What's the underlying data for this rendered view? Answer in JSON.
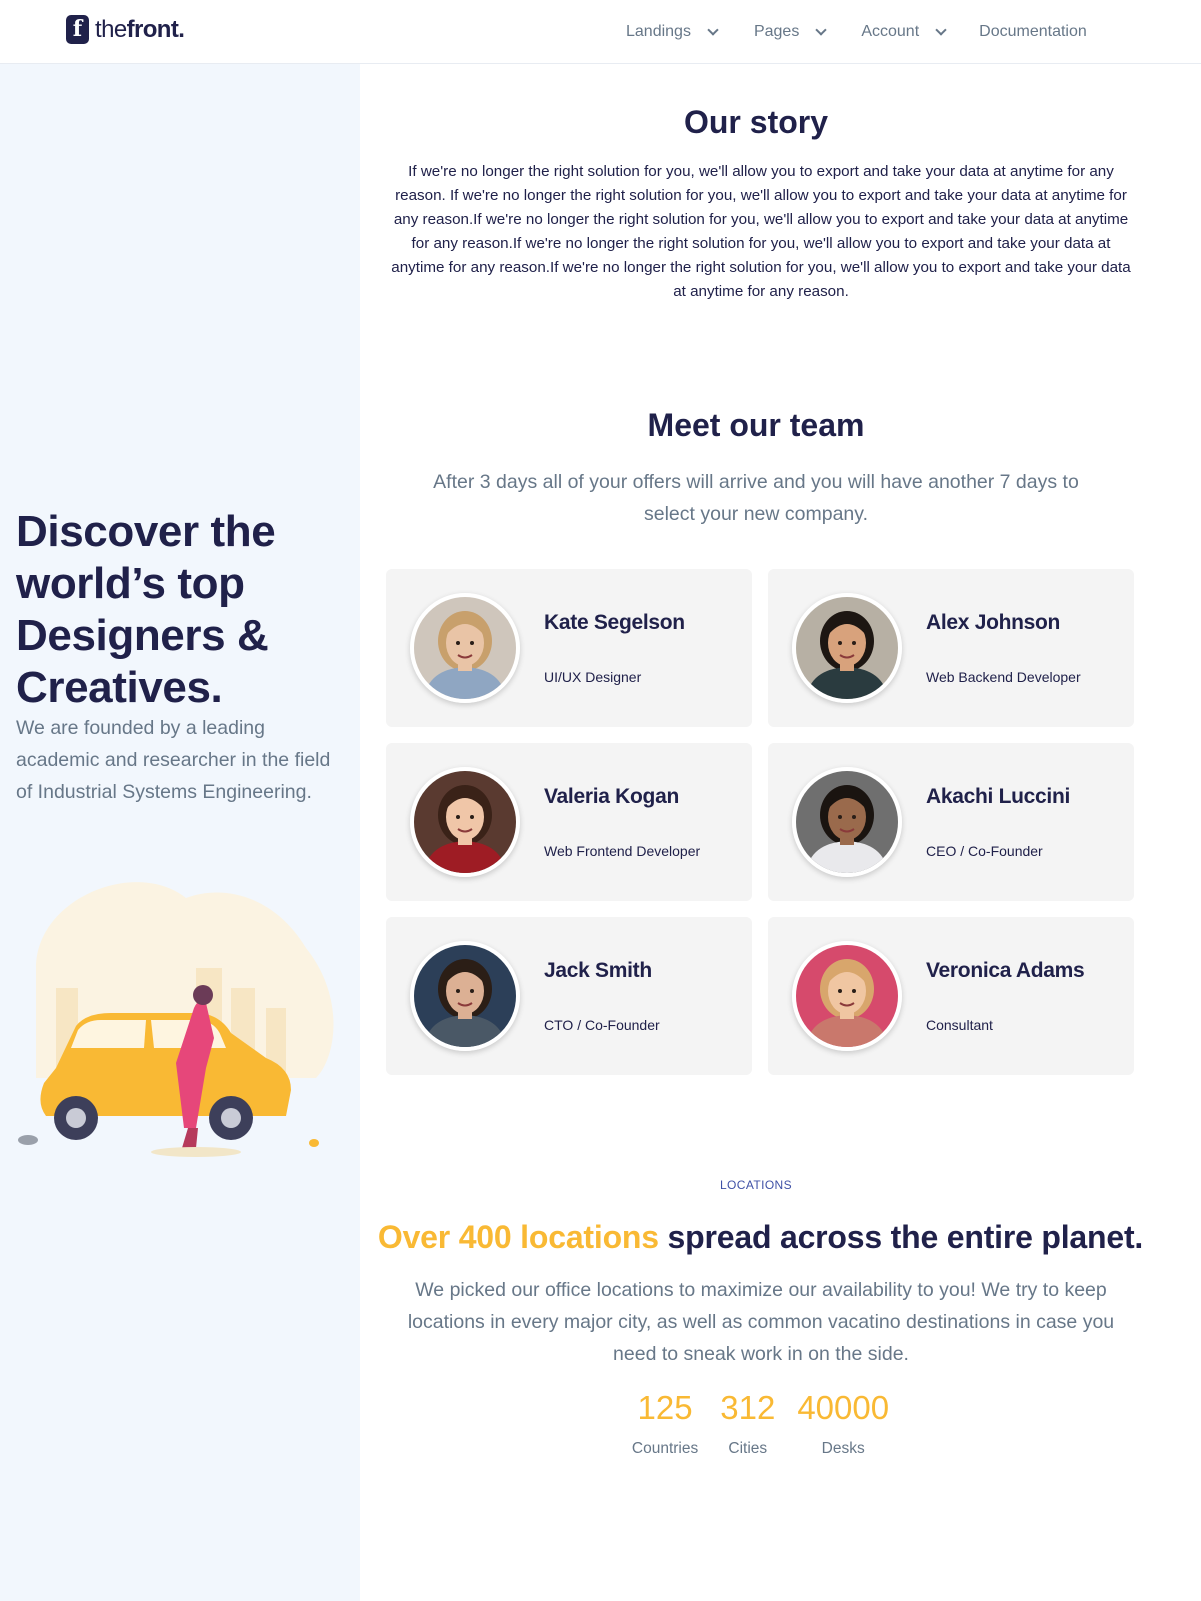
{
  "header": {
    "logo_letter": "f",
    "logo_text_a": "the",
    "logo_text_b": "front",
    "logo_text_c": ".",
    "nav": [
      {
        "label": "Landings",
        "dropdown": true
      },
      {
        "label": "Pages",
        "dropdown": true
      },
      {
        "label": "Account",
        "dropdown": true
      },
      {
        "label": "Documentation",
        "dropdown": false
      }
    ]
  },
  "hero": {
    "title": "Discover the world’s top Designers & Creatives.",
    "subtitle": "We are founded by a leading academic and researcher in the field of Industrial Systems Engineering.",
    "illustration_icon": "car-woman-illustration"
  },
  "story": {
    "title": "Our story",
    "body": "If we're no longer the right solution for you, we'll allow you to export and take your data at anytime for any reason. If we're no longer the right solution for you, we'll allow you to export and take your data at anytime for any reason.If we're no longer the right solution for you, we'll allow you to export and take your data at anytime for any reason.If we're no longer the right solution for you, we'll allow you to export and take your data at anytime for any reason.If we're no longer the right solution for you, we'll allow you to export and take your data at anytime for any reason."
  },
  "team": {
    "title": "Meet our team",
    "subtitle": "After 3 days all of your offers will arrive and you will have another 7 days to select your new company.",
    "members": [
      {
        "name": "Kate Segelson",
        "role": "UI/UX Designer",
        "skin": "#e9c4a6",
        "hair": "#c8a06c",
        "shirt": "#8fa6c2",
        "bg": "#cfc6bc"
      },
      {
        "name": "Alex Johnson",
        "role": "Web Backend Developer",
        "skin": "#d8a27c",
        "hair": "#1d1612",
        "shirt": "#2a3b3f",
        "bg": "#b7b0a4"
      },
      {
        "name": "Valeria Kogan",
        "role": "Web Frontend Developer",
        "skin": "#f0c6a8",
        "hair": "#3a2218",
        "shirt": "#9e1c24",
        "bg": "#5a3a30"
      },
      {
        "name": "Akachi Luccini",
        "role": "CEO / Co-Founder",
        "skin": "#9a6a4c",
        "hair": "#1a1410",
        "shirt": "#e9e9ec",
        "bg": "#6f6f6f"
      },
      {
        "name": "Jack Smith",
        "role": "CTO / Co-Founder",
        "skin": "#dcb094",
        "hair": "#2b1e16",
        "shirt": "#4a5866",
        "bg": "#2c3f58"
      },
      {
        "name": "Veronica Adams",
        "role": "Consultant",
        "skin": "#f0c6a2",
        "hair": "#d8a66c",
        "shirt": "#c9786c",
        "bg": "#d64a6c"
      }
    ]
  },
  "locations": {
    "eyebrow": "LOCATIONS",
    "title_highlight": "Over 400 locations",
    "title_rest": " spread across the entire planet.",
    "body": "We picked our office locations to maximize our availability to you! We try to keep locations in every major city, as well as common vacatino destinations in case you need to sneak work in on the side.",
    "stats": [
      {
        "value": "125",
        "label": "Countries"
      },
      {
        "value": "312",
        "label": "Cities"
      },
      {
        "value": "40000",
        "label": "Desks"
      }
    ]
  },
  "colors": {
    "accent": "#f9b934",
    "heading": "#20214a",
    "muted": "#677788",
    "left_panel_bg": "#f2f7fd",
    "card_bg": "#f4f4f4"
  }
}
